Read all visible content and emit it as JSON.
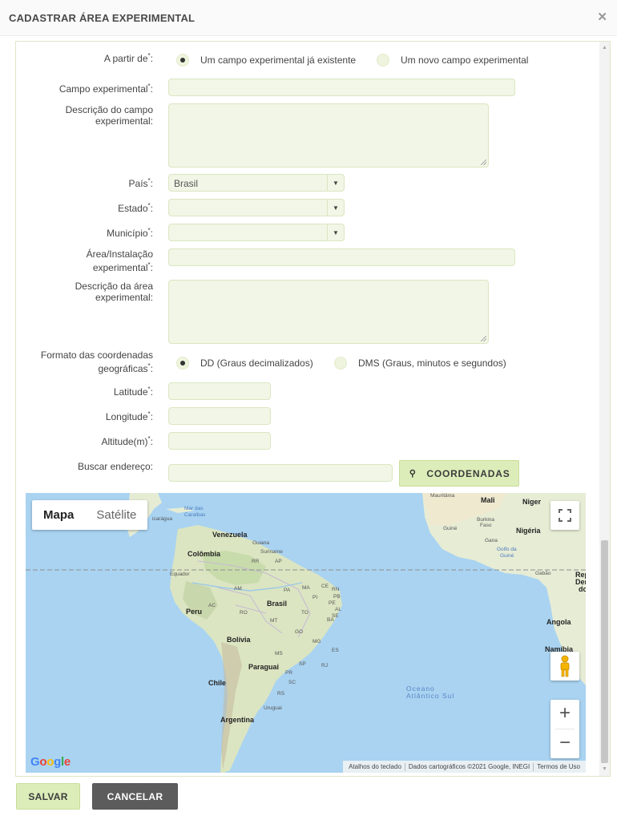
{
  "dialog": {
    "title": "CADASTRAR ÁREA EXPERIMENTAL",
    "close_icon": "close-icon"
  },
  "form": {
    "origin": {
      "label": "A partir de",
      "req": "*",
      "colon": ":",
      "options": [
        {
          "label": "Um campo experimental já existente",
          "selected": true
        },
        {
          "label": "Um novo campo experimental",
          "selected": false
        }
      ]
    },
    "field_name": {
      "label": "Campo experimental",
      "req": "*",
      "colon": ":",
      "value": ""
    },
    "field_description": {
      "label_line1": "Descrição do campo",
      "label_line2": "experimental:",
      "value": ""
    },
    "country": {
      "label": "País",
      "req": "*",
      "colon": ":",
      "value": "Brasil"
    },
    "state": {
      "label": "Estado",
      "req": "*",
      "colon": ":",
      "value": ""
    },
    "city": {
      "label": "Município",
      "req": "*",
      "colon": ":",
      "value": ""
    },
    "area_name": {
      "label_line1": "Área/Instalação",
      "label_line2": "experimental",
      "req": "*",
      "colon": ":",
      "value": ""
    },
    "area_description": {
      "label_line1": "Descrição da área",
      "label_line2": "experimental:",
      "value": ""
    },
    "coord_format": {
      "label_line1": "Formato das coordenadas",
      "label_line2": "geográficas",
      "req": "*",
      "colon": ":",
      "options": [
        {
          "label": "DD (Graus decimalizados)",
          "selected": true
        },
        {
          "label": "DMS (Graus, minutos e segundos)",
          "selected": false
        }
      ]
    },
    "latitude": {
      "label": "Latitude",
      "req": "*",
      "colon": ":",
      "value": ""
    },
    "longitude": {
      "label": "Longitude",
      "req": "*",
      "colon": ":",
      "value": ""
    },
    "altitude": {
      "label": "Altitude(m)",
      "req": "*",
      "colon": ":",
      "value": ""
    },
    "address_search": {
      "label": "Buscar endereço:",
      "value": ""
    },
    "coords_button": {
      "label": "COORDENADAS",
      "icon": "search-icon"
    }
  },
  "map": {
    "type_buttons": {
      "map": "Mapa",
      "satellite": "Satélite",
      "active": "map"
    },
    "controls": {
      "fullscreen": "fullscreen-icon",
      "streetview": "pegman-icon",
      "zoom_in": "+",
      "zoom_out": "−"
    },
    "logo": "Google",
    "attribution": {
      "shortcuts": "Atalhos do teclado",
      "data": "Dados cartográficos ©2021 Google, INEGI",
      "terms": "Termos de Uso"
    },
    "labels": {
      "mali": "Mali",
      "niger": "Niger",
      "venezuela": "Venezuela",
      "colombia": "Colômbia",
      "guiana": "Guiana",
      "suriname": "Suriname",
      "rr": "RR",
      "ap": "AP",
      "equador": "Equador",
      "am": "AM",
      "pa": "PA",
      "ma": "MA",
      "ce": "CE",
      "rn": "RN",
      "pb": "PB",
      "pi": "PI",
      "pe": "PE",
      "ac": "AC",
      "ro": "RO",
      "brasil": "Brasil",
      "to": "TO",
      "al": "AL",
      "se": "SE",
      "ba": "BA",
      "peru": "Peru",
      "mt": "MT",
      "go": "GO",
      "bolivia": "Bolívia",
      "mg": "MG",
      "es": "ES",
      "ms": "MS",
      "sp": "SP",
      "rj": "RJ",
      "paraguai": "Paraguai",
      "pr": "PR",
      "sc": "SC",
      "rs": "RS",
      "chile": "Chile",
      "uruguai": "Uruguai",
      "argentina": "Argentina",
      "mar_das_1": "Mar das",
      "mar_das_2": "Caraíbas",
      "nicaragua": "icarágua",
      "guine": "Guiné",
      "burkina_1": "Burkina",
      "burkina_2": "Faso",
      "nigeria": "Nigéria",
      "gana": "Gana",
      "golfo_1": "Golfo da",
      "golfo_2": "Guiné",
      "gabao": "Gabão",
      "rep_1": "Rep",
      "rep_2": "Dem",
      "rep_3": "do",
      "angola": "Angola",
      "namibia": "Namíbia",
      "ocean_1": "Oceano",
      "ocean_2": "Atlântico Sul",
      "mauritania": "Mauritânia"
    }
  },
  "footer": {
    "save": "SALVAR",
    "cancel": "CANCELAR"
  }
}
